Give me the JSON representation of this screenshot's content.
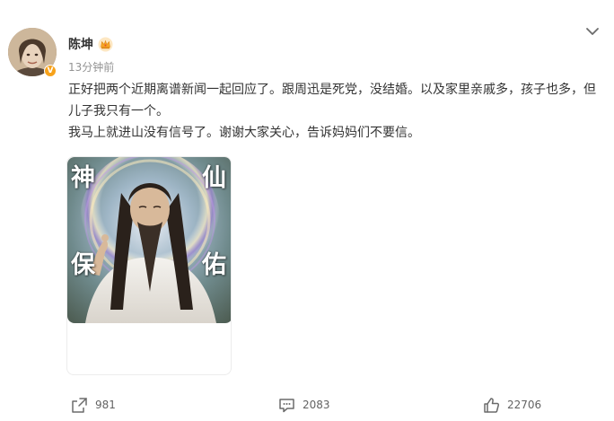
{
  "post": {
    "author": {
      "name": "陈坤",
      "verified_badge": "V",
      "crown_icon": "crown-icon",
      "avatar": "avatar-photo"
    },
    "timestamp": "13分钟前",
    "text": {
      "line1": "正好把两个近期离谱新闻一起回应了。跟周迅是死党，没结婚。以及家里亲戚多，孩子也多，但儿子我只有一个。",
      "line2": "我马上就进山没有信号了。谢谢大家关心，告诉妈妈们不要信。"
    },
    "image": {
      "overlay_chars": [
        "神",
        "仙",
        "保",
        "佑"
      ]
    },
    "actions": {
      "share_count": "981",
      "comment_count": "2083",
      "like_count": "22706"
    }
  },
  "colors": {
    "text": "#333333",
    "meta": "#939393",
    "verified": "#f7a21b",
    "crown": "#f6a623",
    "action": "#636363"
  },
  "icons": {
    "menu": "chevron-down-icon",
    "share": "share-icon",
    "comment": "comment-icon",
    "like": "thumbs-up-icon"
  }
}
